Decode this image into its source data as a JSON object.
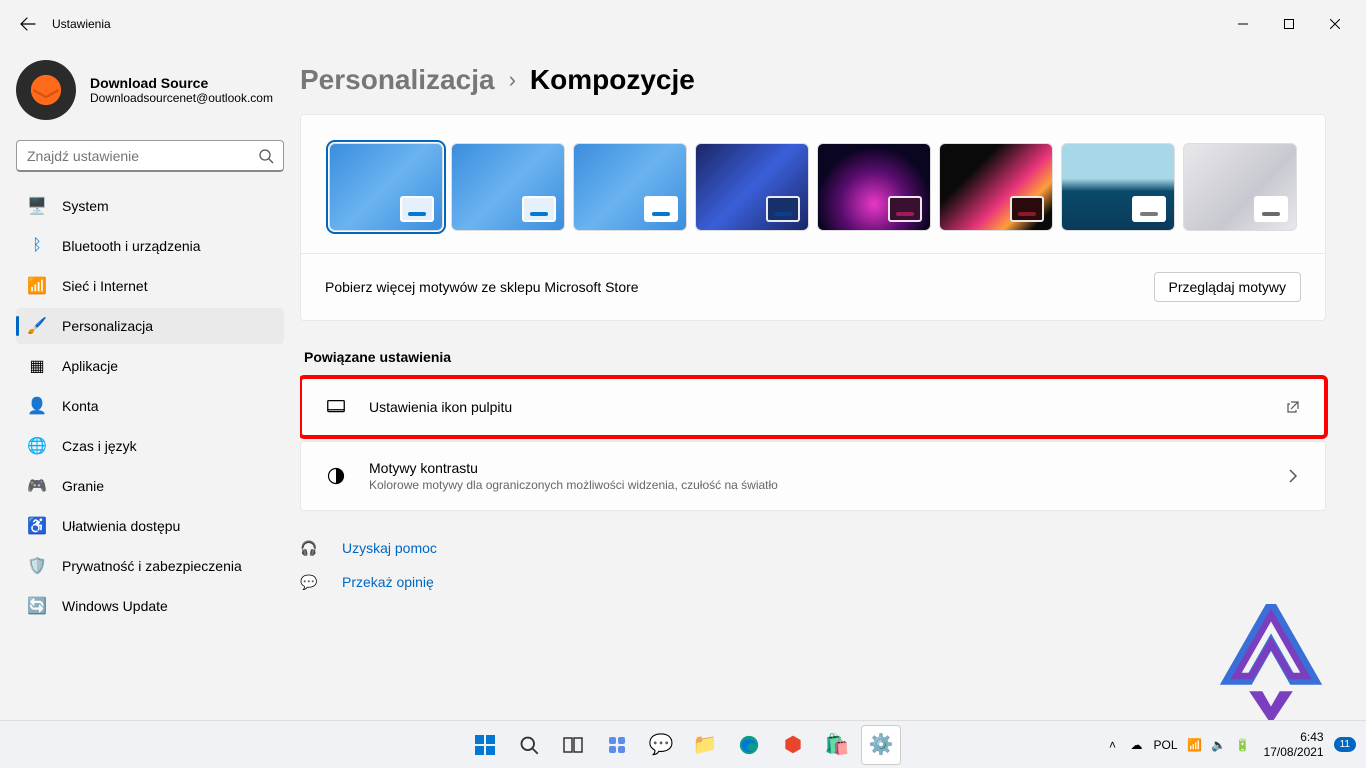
{
  "window": {
    "title": "Ustawienia"
  },
  "user": {
    "name": "Download Source",
    "email": "Downloadsourcenet@outlook.com"
  },
  "search": {
    "placeholder": "Znajdź ustawienie"
  },
  "nav": {
    "system": "System",
    "bluetooth": "Bluetooth i urządzenia",
    "network": "Sieć i Internet",
    "personalization": "Personalizacja",
    "apps": "Aplikacje",
    "accounts": "Konta",
    "timelang": "Czas i język",
    "gaming": "Granie",
    "accessibility": "Ułatwienia dostępu",
    "privacy": "Prywatność i zabezpieczenia",
    "update": "Windows Update"
  },
  "breadcrumb": {
    "parent": "Personalizacja",
    "current": "Kompozycje"
  },
  "store": {
    "text": "Pobierz więcej motywów ze sklepu Microsoft Store",
    "button": "Przeglądaj motywy"
  },
  "section": {
    "related": "Powiązane ustawienia"
  },
  "rows": {
    "desktop_icons": {
      "title": "Ustawienia ikon pulpitu"
    },
    "contrast": {
      "title": "Motywy kontrastu",
      "sub": "Kolorowe motywy dla ograniczonych możliwości widzenia, czułość na światło"
    }
  },
  "links": {
    "help": "Uzyskaj pomoc",
    "feedback": "Przekaż opinię"
  },
  "themes": [
    {
      "key": "w11b",
      "accent": "#0078d4",
      "accent_bg": "#e6f0fb",
      "selected": true
    },
    {
      "key": "w11b",
      "accent": "#0078d4",
      "accent_bg": "#e6f0fb"
    },
    {
      "key": "w11b",
      "accent": "#0078d4",
      "accent_bg": "#ffffff"
    },
    {
      "key": "w11d",
      "accent": "#0b3d91",
      "accent_bg": "#18306a"
    },
    {
      "key": "glow",
      "accent": "#a01a5a",
      "accent_bg": "#3a1030"
    },
    {
      "key": "flow",
      "accent": "#8a1a2a",
      "accent_bg": "#2a0a0a"
    },
    {
      "key": "sun",
      "accent": "#7a7a7a",
      "accent_bg": "#ffffff",
      "light": true
    },
    {
      "key": "gray",
      "accent": "#6a6a6a",
      "accent_bg": "#ffffff",
      "light": true
    }
  ],
  "tray": {
    "lang": "POL",
    "time": "6:43",
    "date": "17/08/2021",
    "notif": "11"
  }
}
